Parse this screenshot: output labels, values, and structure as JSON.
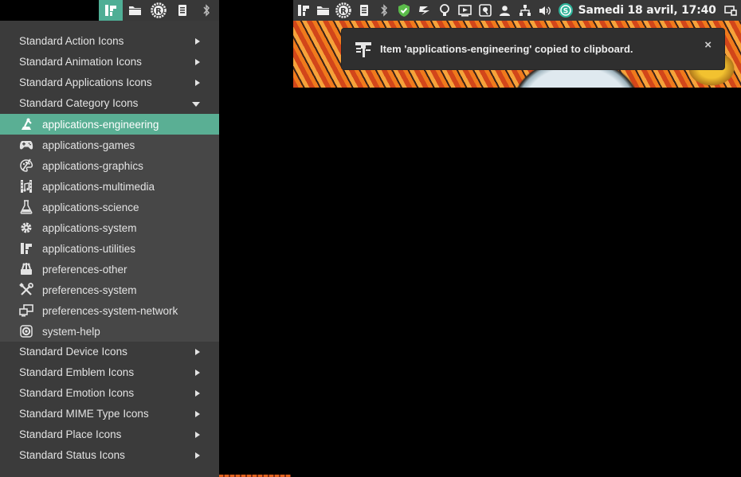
{
  "panel_left": {
    "items": [
      "app-launcher-icon",
      "folder-icon",
      "rust-icon",
      "storage-icon",
      "bluetooth-icon"
    ],
    "active_color": "#4fae95"
  },
  "panel_right": {
    "items": [
      "app-launcher-icon",
      "folder-icon",
      "rust-icon",
      "storage-icon",
      "bluetooth-icon",
      "shield-check-icon",
      "lightning-icon",
      "bulb-icon",
      "media-icon",
      "screenshot-icon",
      "user-icon",
      "network-icon",
      "volume-icon",
      "green-app-icon"
    ],
    "clock": "Samedi 18 avril, 17:40"
  },
  "menu": {
    "categories_before": [
      "Standard Action Icons",
      "Standard Animation Icons",
      "Standard Applications Icons",
      "Standard Category Icons"
    ],
    "expanded_items": [
      {
        "label": "applications-engineering",
        "icon": "engineering-icon",
        "selected": true
      },
      {
        "label": "applications-games",
        "icon": "gamepad-icon",
        "selected": false
      },
      {
        "label": "applications-graphics",
        "icon": "palette-icon",
        "selected": false
      },
      {
        "label": "applications-multimedia",
        "icon": "film-icon",
        "selected": false
      },
      {
        "label": "applications-science",
        "icon": "flask-icon",
        "selected": false
      },
      {
        "label": "applications-system",
        "icon": "gear-icon",
        "selected": false
      },
      {
        "label": "applications-utilities",
        "icon": "utilities-icon",
        "selected": false
      },
      {
        "label": "preferences-other",
        "icon": "other-icon",
        "selected": false
      },
      {
        "label": "preferences-system",
        "icon": "tools-icon",
        "selected": false
      },
      {
        "label": "preferences-system-network",
        "icon": "network-monitors-icon",
        "selected": false
      },
      {
        "label": "system-help",
        "icon": "lifebuoy-icon",
        "selected": false
      }
    ],
    "categories_after": [
      "Standard Device Icons",
      "Standard Emblem Icons",
      "Standard Emotion Icons",
      "Standard MIME Type Icons",
      "Standard Place Icons",
      "Standard Status Icons"
    ],
    "selected_color": "#5aaf94"
  },
  "notification": {
    "icon": "engineering-icon",
    "text": "Item 'applications-engineering' copied to clipboard.",
    "close_label": "×"
  }
}
